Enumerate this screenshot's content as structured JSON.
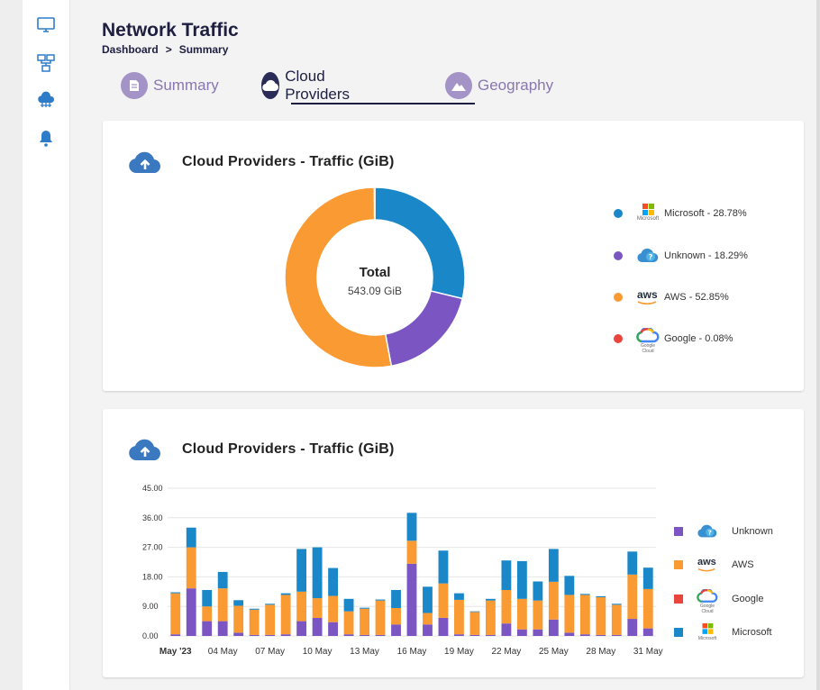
{
  "header": {
    "title": "Network Traffic",
    "breadcrumb": {
      "root": "Dashboard",
      "separator": ">",
      "current": "Summary"
    }
  },
  "sidebar": {
    "items": [
      {
        "icon": "monitor-icon"
      },
      {
        "icon": "network-icon"
      },
      {
        "icon": "cloud-network-icon"
      },
      {
        "icon": "bell-icon"
      }
    ]
  },
  "tabs": [
    {
      "label": "Summary",
      "icon": "summary-icon",
      "active": false
    },
    {
      "label": "Cloud Providers",
      "icon": "cloud-icon",
      "active": true
    },
    {
      "label": "Geography",
      "icon": "mountain-icon",
      "active": false
    }
  ],
  "donut_card": {
    "title": "Cloud Providers - Traffic (GiB)",
    "center_label": "Total",
    "center_value": "543.09 GiB",
    "legend": [
      {
        "label": "Microsoft - 28.78%",
        "color": "#1a87c9",
        "logo": "microsoft-logo-icon",
        "logo_text": "Microsoft"
      },
      {
        "label": "Unknown - 18.29%",
        "color": "#7b56c2",
        "logo": "unknown-cloud-icon"
      },
      {
        "label": "AWS - 52.85%",
        "color": "#f99a32",
        "logo": "aws-logo-icon",
        "logo_text": "aws"
      },
      {
        "label": "Google - 0.08%",
        "color": "#e8453c",
        "logo": "google-cloud-logo-icon",
        "logo_text": "Google Cloud"
      }
    ]
  },
  "bar_card": {
    "title": "Cloud Providers - Traffic (GiB)",
    "legend": [
      {
        "label": "Unknown",
        "color": "#7b56c2",
        "logo": "unknown-cloud-icon"
      },
      {
        "label": "AWS",
        "color": "#f99a32",
        "logo": "aws-logo-icon",
        "logo_text": "aws"
      },
      {
        "label": "Google",
        "color": "#e8453c",
        "logo": "google-cloud-logo-icon",
        "logo_text": "Google Cloud"
      },
      {
        "label": "Microsoft",
        "color": "#1a87c9",
        "logo": "microsoft-logo-icon",
        "logo_text": "Microsoft"
      }
    ]
  },
  "chart_data": [
    {
      "type": "pie",
      "title": "Cloud Providers - Traffic (GiB)",
      "categories": [
        "Microsoft",
        "Unknown",
        "AWS",
        "Google"
      ],
      "values": [
        28.78,
        18.29,
        52.85,
        0.08
      ],
      "colors": [
        "#1a87c9",
        "#7b56c2",
        "#f99a32",
        "#e8453c"
      ],
      "donut": true,
      "legend": "right"
    },
    {
      "type": "bar",
      "stacked": true,
      "title": "Cloud Providers - Traffic (GiB)",
      "xlabel": "",
      "ylabel": "",
      "ylim": [
        0,
        45
      ],
      "yticks": [
        "45.00",
        "36.00",
        "27.00",
        "18.00",
        "9.00",
        "0.00"
      ],
      "ytick_values": [
        45,
        36,
        27,
        18,
        9,
        0
      ],
      "grid": true,
      "legend": "right",
      "x_ticks": [
        {
          "label": "May '23",
          "index": 0,
          "bold": true
        },
        {
          "label": "04 May",
          "index": 3
        },
        {
          "label": "07 May",
          "index": 6
        },
        {
          "label": "10 May",
          "index": 9
        },
        {
          "label": "13 May",
          "index": 12
        },
        {
          "label": "16 May",
          "index": 15
        },
        {
          "label": "19 May",
          "index": 18
        },
        {
          "label": "22 May",
          "index": 21
        },
        {
          "label": "25 May",
          "index": 24
        },
        {
          "label": "28 May",
          "index": 27
        },
        {
          "label": "31 May",
          "index": 30
        }
      ],
      "categories": [
        "01 May",
        "02 May",
        "03 May",
        "04 May",
        "05 May",
        "06 May",
        "07 May",
        "08 May",
        "09 May",
        "10 May",
        "11 May",
        "12 May",
        "13 May",
        "14 May",
        "15 May",
        "16 May",
        "17 May",
        "18 May",
        "19 May",
        "20 May",
        "21 May",
        "22 May",
        "23 May",
        "24 May",
        "25 May",
        "26 May",
        "27 May",
        "28 May",
        "29 May",
        "30 May",
        "31 May"
      ],
      "series": [
        {
          "name": "Unknown",
          "color": "#7b56c2",
          "values": [
            0.5,
            14.5,
            4.5,
            4.5,
            1.0,
            0.3,
            0.3,
            0.5,
            4.5,
            5.5,
            4.2,
            0.5,
            0.3,
            0.3,
            3.5,
            22.0,
            3.5,
            5.5,
            0.5,
            0.3,
            0.3,
            3.8,
            2.0,
            2.0,
            5.0,
            1.0,
            0.5,
            0.3,
            0.3,
            5.2,
            2.3
          ]
        },
        {
          "name": "AWS",
          "color": "#f99a32",
          "values": [
            12.5,
            12.5,
            4.5,
            10.0,
            8.2,
            7.7,
            9.2,
            12.0,
            9.0,
            6.0,
            8.0,
            7.0,
            8.0,
            10.5,
            5.0,
            7.0,
            3.5,
            10.5,
            10.5,
            7.0,
            10.5,
            10.2,
            9.3,
            8.8,
            11.5,
            11.5,
            12.0,
            11.5,
            9.2,
            13.5,
            12.0
          ]
        },
        {
          "name": "Google",
          "color": "#e8453c",
          "values": [
            0,
            0,
            0,
            0,
            0,
            0,
            0,
            0,
            0,
            0,
            0,
            0,
            0,
            0,
            0,
            0,
            0,
            0,
            0,
            0,
            0,
            0,
            0,
            0,
            0,
            0,
            0,
            0,
            0,
            0,
            0
          ]
        },
        {
          "name": "Microsoft",
          "color": "#1a87c9",
          "values": [
            0.3,
            6.0,
            5.0,
            5.0,
            1.7,
            0.3,
            0.3,
            0.5,
            13.0,
            15.5,
            8.5,
            3.8,
            0.3,
            0.3,
            5.5,
            8.5,
            8.0,
            10.0,
            2.0,
            0.2,
            0.5,
            9.0,
            11.5,
            5.8,
            10.0,
            5.8,
            0.3,
            0.3,
            0.3,
            7.0,
            6.5
          ]
        }
      ]
    }
  ]
}
